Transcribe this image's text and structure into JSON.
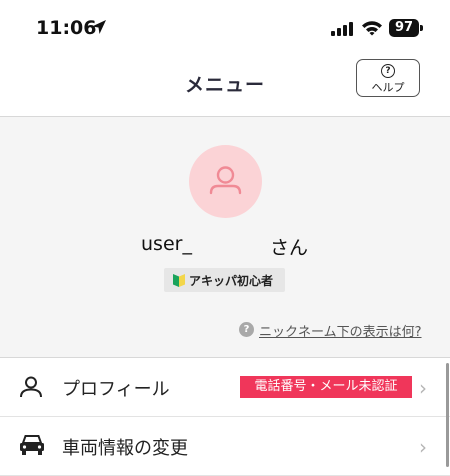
{
  "status_bar": {
    "time": "11:06",
    "battery": "97"
  },
  "header": {
    "title": "メニュー",
    "help_label": "ヘルプ"
  },
  "profile": {
    "user_name": "user_",
    "user_suffix": "さん",
    "rank": "アキッパ初心者",
    "nickname_help": "ニックネーム下の表示は何?"
  },
  "menu": {
    "items": [
      {
        "label": "プロフィール",
        "icon": "person-icon",
        "badge": "電話番号・メール未認証"
      },
      {
        "label": "車両情報の変更",
        "icon": "car-icon"
      }
    ]
  },
  "colors": {
    "avatar_bg": "#fbd3d6",
    "avatar_fg": "#f08a95",
    "warning_badge": "#f0365a",
    "beginner_mark_green": "#1aa35b"
  }
}
